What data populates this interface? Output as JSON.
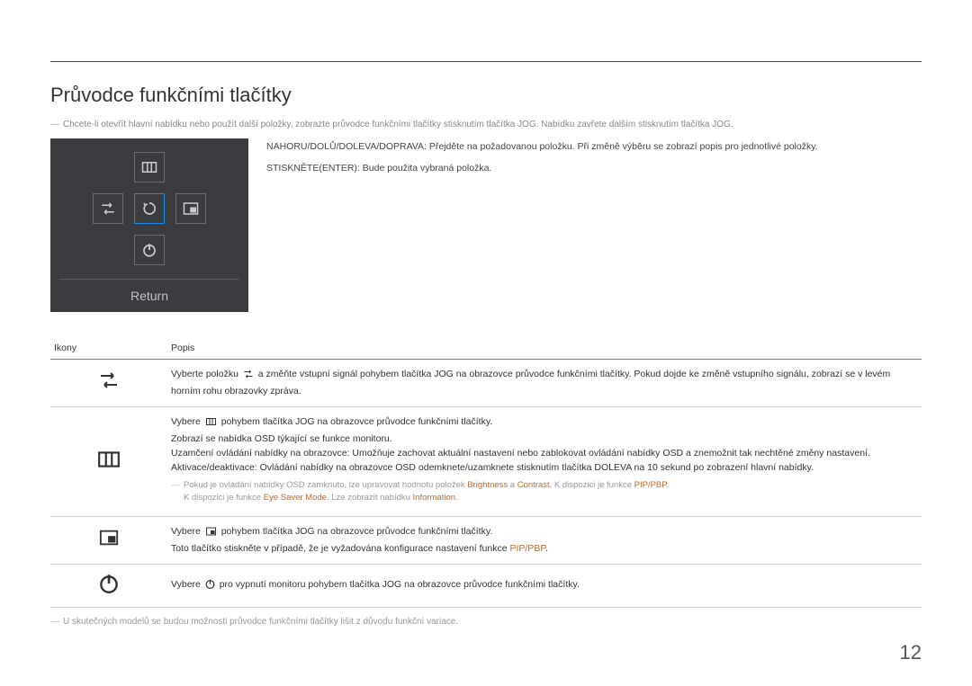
{
  "page": {
    "title": "Průvodce funkčními tlačítky",
    "intro_note": "Chcete-li otevřít hlavní nabídku nebo použít další položky, zobrazte průvodce funkčními tlačítky stisknutím tlačítka JOG. Nabídku zavřete dalším stisknutím tlačítka JOG.",
    "page_number": "12"
  },
  "osd": {
    "footer": "Return"
  },
  "instructions": {
    "line1": "NAHORU/DOLŮ/DOLEVA/DOPRAVA: Přejděte na požadovanou položku. Při změně výběru se zobrazí popis pro jednotlivé položky.",
    "line2": "STISKNĚTE(ENTER): Bude použita vybraná položka."
  },
  "table": {
    "headers": {
      "icons": "Ikony",
      "desc": "Popis"
    },
    "rows": [
      {
        "desc_pre": "Vyberte položku ",
        "desc_post": " a změňte vstupní signál pohybem tlačítka JOG na obrazovce průvodce funkčními tlačítky. Pokud dojde ke změně vstupního signálu, zobrazí se v levém horním rohu obrazovky zpráva."
      },
      {
        "p1_pre": "Vybere ",
        "p1_post": " pohybem tlačítka JOG na obrazovce průvodce funkčními tlačítky.",
        "p2": "Zobrazí se nabídka OSD týkající se funkce monitoru.",
        "p3": "Uzamčení ovládání nabídky na obrazovce: Umožňuje zachovat aktuální nastavení nebo zablokovat ovládání nabídky OSD a znemožnit tak nechtěné změny nastavení.",
        "p4": "Aktivace/deaktivace: Ovládání nabídky na obrazovce OSD odemknete/uzamknete stisknutím tlačítka DOLEVA na 10 sekund po zobrazení hlavní nabídky.",
        "note1_a": "Pokud je ovládání nabídky OSD zamknuto, lze upravovat hodnotu položek ",
        "note1_brightness": "Brightness",
        "note1_b": " a ",
        "note1_contrast": "Contrast",
        "note1_c": ". K dispozici je funkce ",
        "note1_pip": "PIP/PBP",
        "note1_d": ".",
        "note2_a": "K dispozici je funkce ",
        "note2_eye": "Eye Saver Mode",
        "note2_b": ". Lze zobrazit nabídku ",
        "note2_info": "Information",
        "note2_c": "."
      },
      {
        "p1_pre": "Vybere ",
        "p1_post": " pohybem tlačítka JOG na obrazovce průvodce funkčními tlačítky.",
        "p2_a": "Toto tlačítko stiskněte v případě, že je vyžadována konfigurace nastavení funkce ",
        "p2_pip": "PIP/PBP",
        "p2_b": "."
      },
      {
        "p1_pre": "Vybere ",
        "p1_post": " pro vypnutí monitoru pohybem tlačítka JOG na obrazovce průvodce funkčními tlačítky."
      }
    ],
    "footer_note": "U skutečných modelů se budou možnosti průvodce funkčními tlačítky lišit z důvodu funkční variace."
  }
}
